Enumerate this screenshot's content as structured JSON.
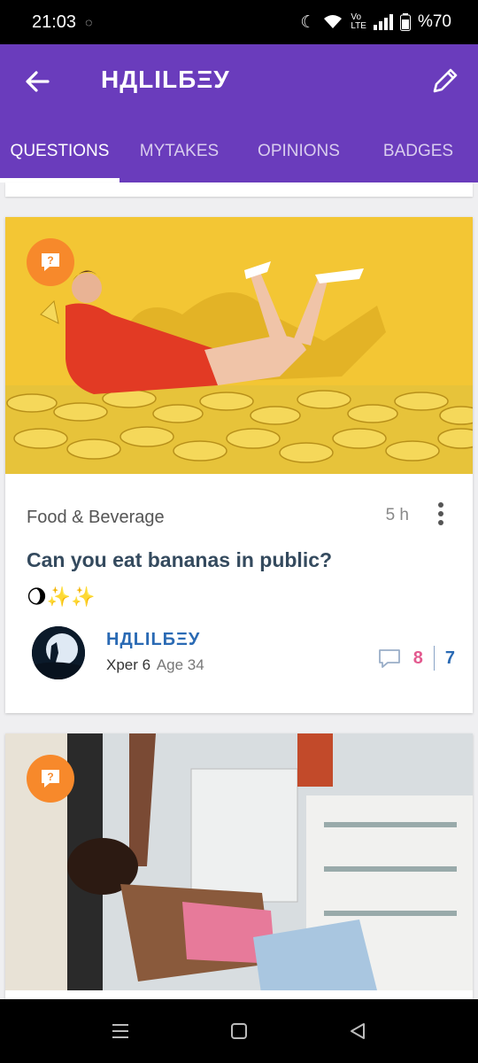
{
  "status": {
    "time": "21:03",
    "battery": "%70",
    "icons": [
      "sync-icon",
      "moon-icon",
      "wifi-icon",
      "volte-icon",
      "signal-icon",
      "battery-icon"
    ]
  },
  "appbar": {
    "title": "НДLILБΞУ",
    "back_icon": "arrow-left-icon",
    "edit_icon": "pencil-icon"
  },
  "tabs": [
    {
      "label": "QUESTIONS",
      "active": true
    },
    {
      "label": "MYTAKES",
      "active": false
    },
    {
      "label": "OPINIONS",
      "active": false
    },
    {
      "label": "BADGES",
      "active": false
    }
  ],
  "post": {
    "category": "Food & Beverage",
    "time_ago": "5 h",
    "title": "Can you eat bananas in public?",
    "emoji": "🌖✨✨",
    "author": {
      "name": "НДLILБΞУ",
      "level": "Xper 6",
      "age": "Age 34"
    },
    "comments": "8",
    "votes": "7"
  },
  "colors": {
    "accent": "#6a3cbc",
    "badge": "#f7892b",
    "link": "#2a6ab4",
    "pink": "#e35a8f"
  }
}
